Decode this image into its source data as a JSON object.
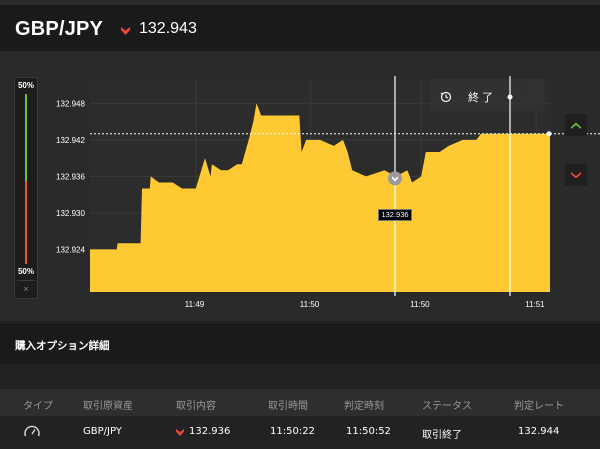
{
  "header": {
    "pair": "GBP/JPY",
    "direction_icon": "price-down-icon",
    "price": "132.943",
    "down_color": "#e8473a"
  },
  "ratio_meter": {
    "top_label": "50%",
    "bottom_label": "50%",
    "close_label": "×",
    "high_ratio": 0.5,
    "low_ratio": 0.5,
    "high_color": "#6cbf3b",
    "low_color": "#e8542a"
  },
  "chart": {
    "end_label": "終了",
    "end_icon": "clock-icon",
    "current_price_tag": "132.936",
    "fill_color": "#ffc933"
  },
  "chart_data": {
    "type": "area",
    "y_ticks": [
      "132.948",
      "132.942",
      "132.936",
      "132.930",
      "132.924"
    ],
    "x_ticks": [
      "11:49",
      "11:50",
      "11:50",
      "11:51"
    ],
    "ylim": [
      132.917,
      132.952
    ],
    "xlim": [
      0,
      1
    ],
    "current_price": 132.943,
    "entry_price": 132.936,
    "series": [
      {
        "values": [
          [
            0.0,
            132.924
          ],
          [
            0.058,
            132.924
          ],
          [
            0.06,
            132.925
          ],
          [
            0.11,
            132.925
          ],
          [
            0.113,
            132.934
          ],
          [
            0.13,
            132.934
          ],
          [
            0.132,
            132.936
          ],
          [
            0.15,
            132.935
          ],
          [
            0.18,
            132.935
          ],
          [
            0.2,
            132.934
          ],
          [
            0.23,
            132.934
          ],
          [
            0.25,
            132.939
          ],
          [
            0.262,
            132.936
          ],
          [
            0.265,
            132.938
          ],
          [
            0.285,
            132.937
          ],
          [
            0.3,
            132.937
          ],
          [
            0.32,
            132.938
          ],
          [
            0.33,
            132.938
          ],
          [
            0.345,
            132.942
          ],
          [
            0.355,
            132.945
          ],
          [
            0.362,
            132.948
          ],
          [
            0.372,
            132.946
          ],
          [
            0.39,
            132.946
          ],
          [
            0.42,
            132.946
          ],
          [
            0.455,
            132.946
          ],
          [
            0.46,
            132.94
          ],
          [
            0.47,
            132.942
          ],
          [
            0.5,
            132.942
          ],
          [
            0.53,
            132.941
          ],
          [
            0.55,
            132.942
          ],
          [
            0.56,
            132.94
          ],
          [
            0.57,
            132.937
          ],
          [
            0.6,
            132.936
          ],
          [
            0.64,
            132.937
          ],
          [
            0.665,
            132.936
          ],
          [
            0.69,
            132.937
          ],
          [
            0.7,
            132.935
          ],
          [
            0.72,
            132.936
          ],
          [
            0.73,
            132.94
          ],
          [
            0.76,
            132.94
          ],
          [
            0.78,
            132.941
          ],
          [
            0.81,
            132.942
          ],
          [
            0.84,
            132.942
          ],
          [
            0.85,
            132.943
          ],
          [
            0.88,
            132.943
          ],
          [
            0.96,
            132.943
          ],
          [
            1.0,
            132.943
          ]
        ]
      }
    ],
    "grid": true,
    "legend": "none"
  },
  "side_buttons": {
    "high_icon": "arrow-up-icon",
    "high_color": "#6cbf3b",
    "low_icon": "arrow-down-icon",
    "low_color": "#e8473a"
  },
  "details": {
    "title": "購入オプション詳細",
    "columns": [
      "タイプ",
      "取引原資産",
      "取引内容",
      "取引時間",
      "判定時刻",
      "ステータス",
      "判定レート"
    ],
    "row": {
      "type_icon": "gauge-icon",
      "asset": "GBP/JPY",
      "direction_icon": "price-down-icon",
      "entry": "132.936",
      "trade_time": "11:50:22",
      "judge_time": "11:50:52",
      "status": "取引終了",
      "judge_rate": "132.944"
    }
  }
}
